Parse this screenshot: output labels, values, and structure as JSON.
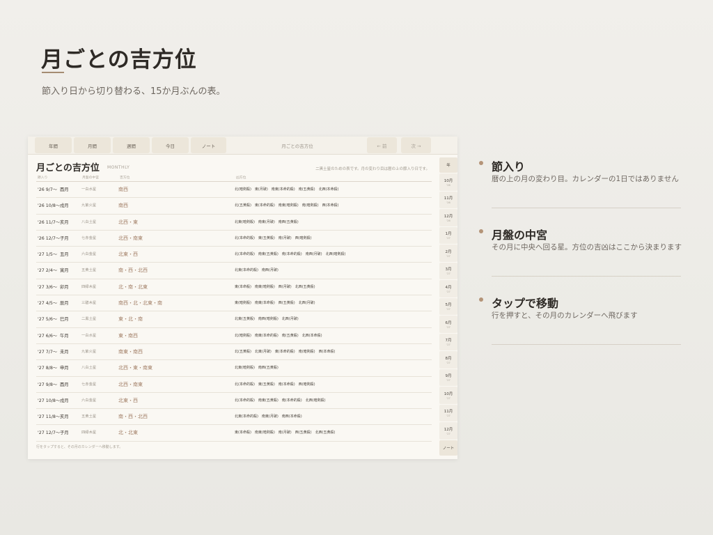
{
  "page": {
    "title": "月ごとの吉方位",
    "subtitle": "節入り日から切り替わる、15か月ぶんの表。"
  },
  "tabs": [
    {
      "label": "年間"
    },
    {
      "label": "月間"
    },
    {
      "label": "週間"
    },
    {
      "label": "今日"
    },
    {
      "label": "ノート"
    }
  ],
  "current_view": "月ごとの吉方位",
  "nav": {
    "prev": "← 前",
    "next": "次 →"
  },
  "content": {
    "title": "月ごとの吉方位",
    "sub": "MONTHLY",
    "note": "二黒土星のための表です。月の変わり目は暦の上の節入り日です。",
    "headers": [
      "節入り",
      "月盤の中宮",
      "吉方位",
      "凶方位"
    ],
    "footnote": "行をタップすると、その月のカレンダーへ移動します。"
  },
  "rows": [
    {
      "date": "'26 9/7〜",
      "branch": "酉月",
      "star": "一白水星",
      "dir": "南西",
      "detail": "北(暗剣殺)　東(月破)　南東(本命的殺)　南(五黄殺)　北西(本命殺)"
    },
    {
      "date": "'26 10/8〜",
      "branch": "戌月",
      "star": "九紫火星",
      "dir": "南西",
      "detail": "北(五黄殺)　東(本命的殺)　南東(暗剣殺)　南(暗剣殺)　西(本命殺)"
    },
    {
      "date": "'26 11/7〜",
      "branch": "亥月",
      "star": "八白土星",
      "dir": "北西・東",
      "detail": "北東(暗剣殺)　南東(月破)　南西(五黄殺)"
    },
    {
      "date": "'26 12/7〜",
      "branch": "子月",
      "star": "七赤金星",
      "dir": "北西・南東",
      "detail": "北(本命的殺)　東(五黄殺)　南(月破)　西(暗剣殺)"
    },
    {
      "date": "'27 1/5〜",
      "branch": "丑月",
      "star": "六白金星",
      "dir": "北東・西",
      "detail": "北(本命的殺)　南東(五黄殺)　南(本命的殺)　南西(月破)　北西(暗剣殺)"
    },
    {
      "date": "'27 2/4〜",
      "branch": "寅月",
      "star": "五黄土星",
      "dir": "南・西・北西",
      "detail": "北東(本命的殺)　南西(月破)"
    },
    {
      "date": "'27 3/6〜",
      "branch": "卯月",
      "star": "四緑木星",
      "dir": "北・南・北東",
      "detail": "東(本命殺)　南東(暗剣殺)　西(月破)　北西(五黄殺)"
    },
    {
      "date": "'27 4/5〜",
      "branch": "辰月",
      "star": "三碧木星",
      "dir": "南西・北・北東・南",
      "detail": "東(暗剣殺)　南東(本命殺)　西(五黄殺)　北西(月破)"
    },
    {
      "date": "'27 5/6〜",
      "branch": "巳月",
      "star": "二黒土星",
      "dir": "東・北・南",
      "detail": "北東(五黄殺)　南西(暗剣殺)　北西(月破)"
    },
    {
      "date": "'27 6/6〜",
      "branch": "午月",
      "star": "一白水星",
      "dir": "東・南西",
      "detail": "北(暗剣殺)　南東(本命的殺)　南(五黄殺)　北西(本命殺)"
    },
    {
      "date": "'27 7/7〜",
      "branch": "未月",
      "star": "九紫火星",
      "dir": "南東・南西",
      "detail": "北(五黄殺)　北東(月破)　東(本命的殺)　南(暗剣殺)　西(本命殺)"
    },
    {
      "date": "'27 8/8〜",
      "branch": "申月",
      "star": "八白土星",
      "dir": "北西・東・南東",
      "detail": "北東(暗剣殺)　南西(五黄殺)"
    },
    {
      "date": "'27 9/8〜",
      "branch": "酉月",
      "star": "七赤金星",
      "dir": "北西・南東",
      "detail": "北(本命的殺)　東(五黄殺)　南(本命殺)　西(暗剣殺)"
    },
    {
      "date": "'27 10/8〜",
      "branch": "戌月",
      "star": "六白金星",
      "dir": "北東・西",
      "detail": "北(本命的殺)　南東(五黄殺)　南(本命的殺)　北西(暗剣殺)"
    },
    {
      "date": "'27 11/8〜",
      "branch": "亥月",
      "star": "五黄土星",
      "dir": "南・西・北西",
      "detail": "北東(本命的殺)　南東(月破)　南西(本命殺)"
    },
    {
      "date": "'27 12/7〜",
      "branch": "子月",
      "star": "四緑木星",
      "dir": "北・北東",
      "detail": "東(本命殺)　南東(暗剣殺)　南(月破)　西(五黄殺)　北西(五黄殺)"
    }
  ],
  "rail": {
    "top": "年",
    "months": [
      {
        "m": "10月",
        "y": "'26"
      },
      {
        "m": "11月",
        "y": "'26"
      },
      {
        "m": "12月",
        "y": "'26"
      },
      {
        "m": "1月",
        "y": "'27"
      },
      {
        "m": "2月",
        "y": "'27"
      },
      {
        "m": "3月",
        "y": "'27"
      },
      {
        "m": "4月",
        "y": "'27"
      },
      {
        "m": "5月",
        "y": "'27"
      },
      {
        "m": "6月",
        "y": "'27"
      },
      {
        "m": "7月",
        "y": "'27"
      },
      {
        "m": "8月",
        "y": "'27"
      },
      {
        "m": "9月",
        "y": "'27"
      },
      {
        "m": "10月",
        "y": "'27"
      },
      {
        "m": "11月",
        "y": "'27"
      },
      {
        "m": "12月",
        "y": "'27"
      }
    ],
    "bottom": "ノート"
  },
  "legend": [
    {
      "title": "節入り",
      "desc": "暦の上の月の変わり目。カレンダーの1日ではありません"
    },
    {
      "title": "月盤の中宮",
      "desc": "その月に中央へ回る星。方位の吉凶はここから決まります"
    },
    {
      "title": "タップで移動",
      "desc": "行を押すと、その月のカレンダーへ飛びます"
    }
  ]
}
